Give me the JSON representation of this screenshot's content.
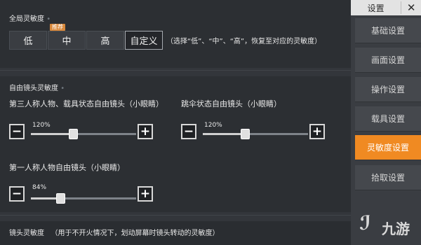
{
  "global": {
    "title": "全局灵敏度",
    "options": [
      "低",
      "中",
      "高",
      "自定义"
    ],
    "badge": "推荐",
    "hint": "（选择“低”、“中”、“高”，恢复至对应的灵敏度）"
  },
  "free_look": {
    "title": "自由镜头灵敏度",
    "sliders": [
      {
        "label": "第三人称人物、载具状态自由镜头（小眼睛）",
        "value": 120,
        "value_text": "120%",
        "max": 300
      },
      {
        "label": "跳伞状态自由镜头（小眼睛）",
        "value": 120,
        "value_text": "120%",
        "max": 300
      },
      {
        "label": "第一人称人物自由镜头（小眼睛）",
        "value": 84,
        "value_text": "84%",
        "max": 300
      }
    ]
  },
  "lens": {
    "title": "镜头灵敏度",
    "desc": "（用于不开火情况下，划动屏幕时镜头转动的灵敏度）"
  },
  "sidebar": {
    "title": "设置",
    "close": "✕",
    "items": [
      "基础设置",
      "画面设置",
      "操作设置",
      "载具设置",
      "灵敏度设置",
      "拾取设置"
    ],
    "active_index": 4
  },
  "watermark": {
    "glyph": "ℐ",
    "text": "九游"
  }
}
